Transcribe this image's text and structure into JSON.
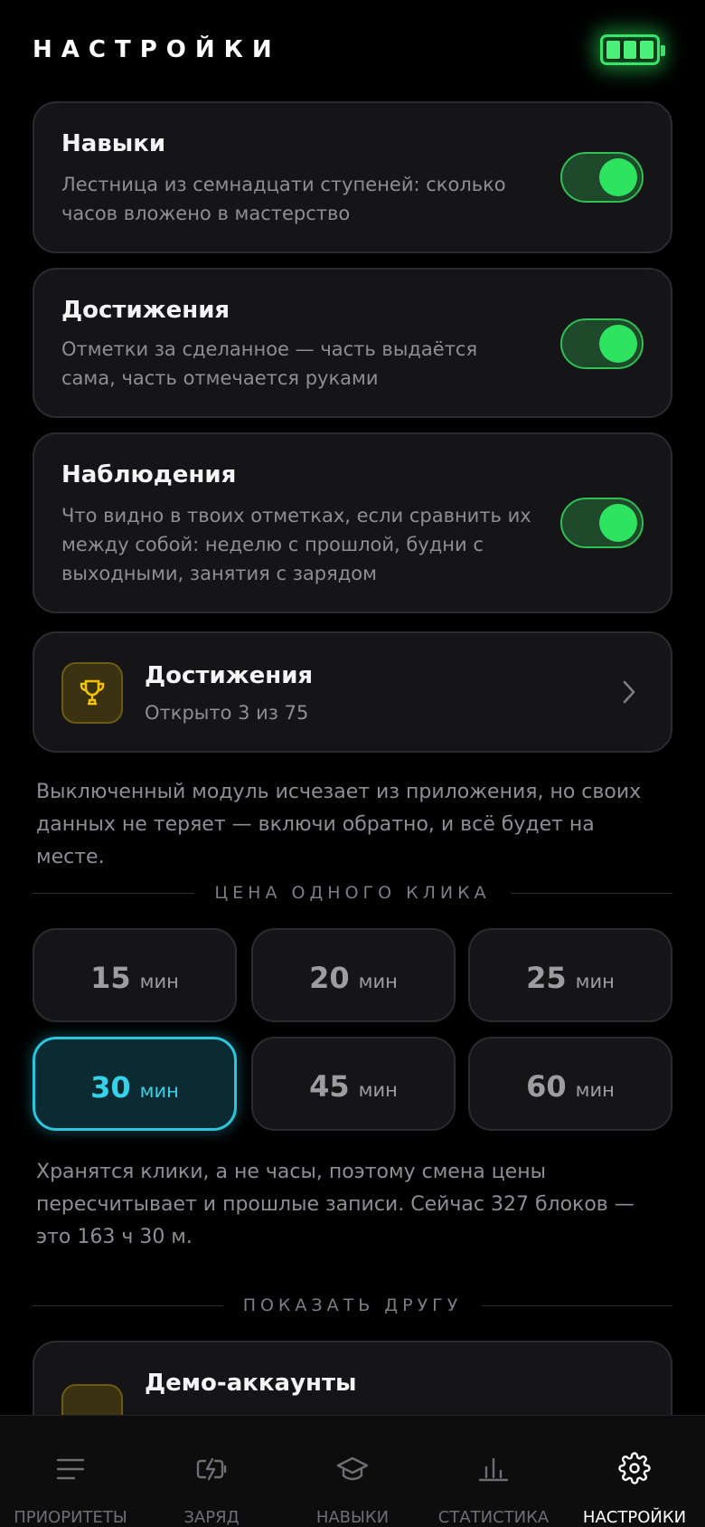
{
  "header": {
    "title": "НАСТРОЙКИ",
    "battery_icon": "battery-full-icon",
    "battery_level": 1.0
  },
  "modules": [
    {
      "title": "Навыки",
      "description": "Лестница из семнадцати ступеней: сколько часов вложено в мастерство",
      "enabled": true
    },
    {
      "title": "Достижения",
      "description": "Отметки за сделанное — часть выдаётся сама, часть отмечается руками",
      "enabled": true
    },
    {
      "title": "Наблюдения",
      "description": "Что видно в твоих отметках, если сравнить их между собой: неделю с прошлой, будни с выходными, занятия с зарядом",
      "enabled": true
    }
  ],
  "achievements_link": {
    "title": "Достижения",
    "subtitle": "Открыто 3 из 75",
    "icon": "trophy-icon"
  },
  "modules_note": "Выключенный модуль исчезает из приложения, но своих данных не теряет — включи обратно, и всё будет на месте.",
  "click_price": {
    "section_title": "ЦЕНА ОДНОГО КЛИКА",
    "options": [
      {
        "value": "15",
        "unit": "мин"
      },
      {
        "value": "20",
        "unit": "мин"
      },
      {
        "value": "25",
        "unit": "мин"
      },
      {
        "value": "30",
        "unit": "мин"
      },
      {
        "value": "45",
        "unit": "мин"
      },
      {
        "value": "60",
        "unit": "мин"
      }
    ],
    "selected": "30",
    "note": "Хранятся клики, а не часы, поэтому смена цены пересчитывает и прошлые записи. Сейчас 327 блоков — это 163 ч 30 м."
  },
  "share": {
    "section_title": "ПОКАЗАТЬ ДРУГУ",
    "demo_title": "Демо-аккаунты"
  },
  "tabbar": [
    {
      "label": "ПРИОРИТЕТЫ",
      "icon": "list-icon"
    },
    {
      "label": "ЗАРЯД",
      "icon": "charge-icon"
    },
    {
      "label": "НАВЫКИ",
      "icon": "graduation-cap-icon"
    },
    {
      "label": "СТАТИСТИКА",
      "icon": "bar-chart-icon"
    },
    {
      "label": "НАСТРОЙКИ",
      "icon": "gear-icon",
      "active": true
    }
  ],
  "colors": {
    "accent_green": "#2ee35f",
    "accent_cyan": "#35d3ea",
    "trophy_gold": "#f5c400"
  }
}
